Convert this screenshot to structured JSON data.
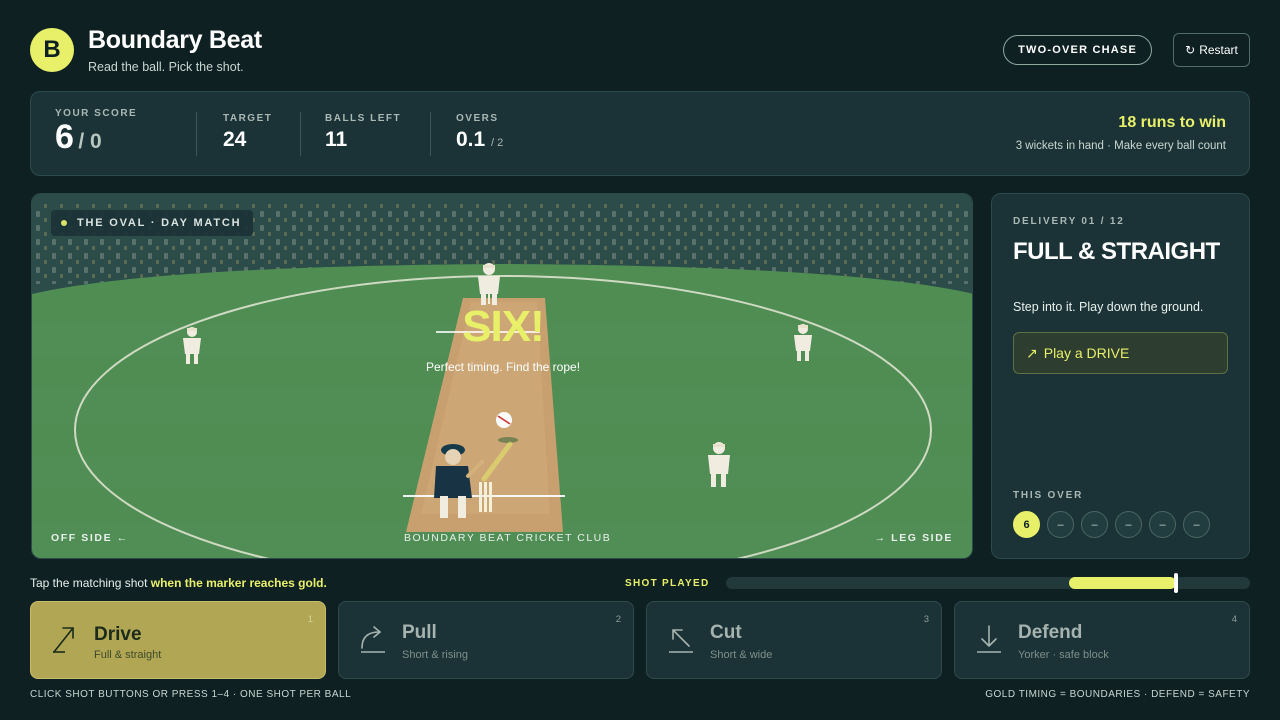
{
  "app": {
    "logo_letter": "B",
    "title": "Boundary Beat",
    "tagline": "Read the ball. Pick the shot.",
    "mode_label": "TWO-OVER CHASE",
    "restart_label": "Restart",
    "restart_icon": "↻"
  },
  "scoreboard": {
    "score_label": "YOUR SCORE",
    "runs": "6",
    "wickets": "/ 0",
    "target_label": "TARGET",
    "target": "24",
    "balls_left_label": "BALLS LEFT",
    "balls_left": "11",
    "overs_label": "OVERS",
    "overs": "0.1",
    "overs_total": "/ 2",
    "need_text": "18 runs to win",
    "need_sub": "3 wickets in hand · Make every ball count"
  },
  "field": {
    "venue": "THE OVAL · DAY MATCH",
    "result": "SIX!",
    "result_sub": "Perfect timing. Find the rope!",
    "off_side": "OFF SIDE ←",
    "club": "BOUNDARY BEAT CRICKET CLUB",
    "leg_side": "→ LEG SIDE"
  },
  "delivery": {
    "label": "DELIVERY 01 / 12",
    "name": "FULL & STRAIGHT",
    "hint": "Step into it. Play down the ground.",
    "play_icon": "↗",
    "play_label": "Play a DRIVE",
    "over_label": "THIS OVER",
    "balls": [
      "6",
      "–",
      "–",
      "–",
      "–",
      "–"
    ]
  },
  "timing": {
    "instruction_prefix": "Tap the matching shot ",
    "instruction_highlight": "when the marker reaches gold.",
    "shot_played_label": "SHOT PLAYED"
  },
  "shots": [
    {
      "name": "Drive",
      "desc": "Full & straight",
      "key": "1",
      "icon": "drive-icon",
      "active": true
    },
    {
      "name": "Pull",
      "desc": "Short & rising",
      "key": "2",
      "icon": "pull-icon",
      "active": false
    },
    {
      "name": "Cut",
      "desc": "Short & wide",
      "key": "3",
      "icon": "cut-icon",
      "active": false
    },
    {
      "name": "Defend",
      "desc": "Yorker · safe block",
      "key": "4",
      "icon": "defend-icon",
      "active": false
    }
  ],
  "footer": {
    "left": "CLICK SHOT BUTTONS OR PRESS 1–4 · ONE SHOT PER BALL",
    "right": "GOLD TIMING = BOUNDARIES · DEFEND = SAFETY"
  },
  "colors": {
    "accent": "#e8f06a",
    "background": "#0f2023",
    "panel": "#1b3336",
    "grass": "#4f8d53",
    "pitch": "#c8a070"
  }
}
